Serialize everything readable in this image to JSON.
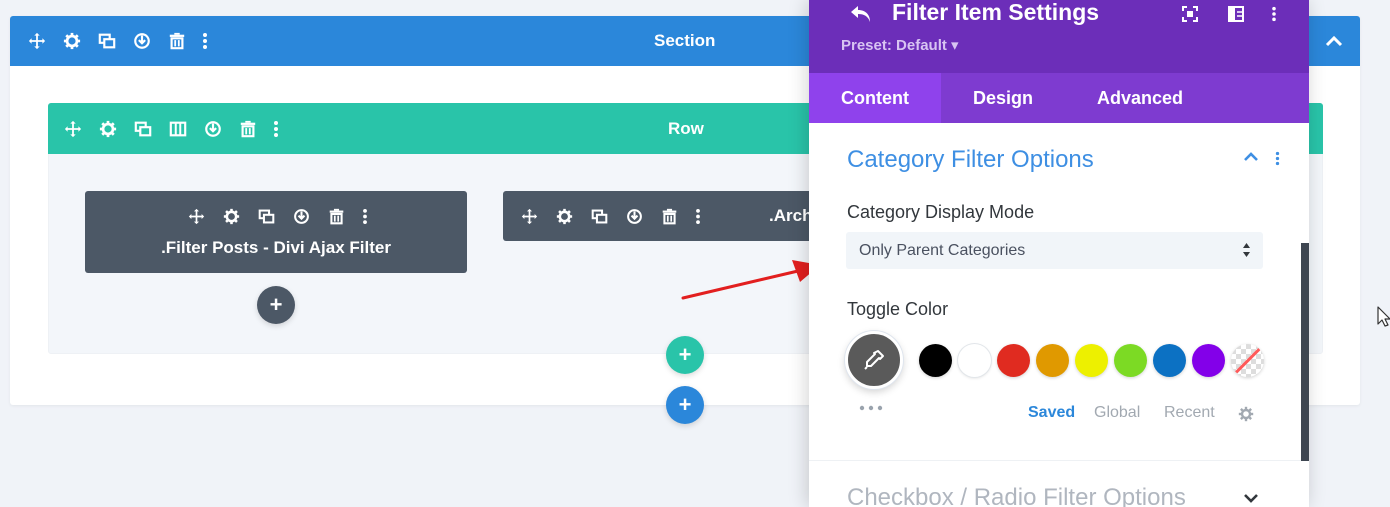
{
  "section": {
    "title": "Section"
  },
  "row": {
    "title": "Row"
  },
  "modules": [
    {
      "title": ".Filter Posts - Divi Ajax Filter"
    },
    {
      "title": ".Arch"
    }
  ],
  "add_buttons": {
    "symbol": "+"
  },
  "colors": {
    "section_bar": "#2b87da",
    "row_bar": "#29c4a9",
    "module_bg": "#4c5866",
    "panel_header": "#6c2eb9",
    "panel_tabs": "#7e3bd0",
    "panel_tab_active": "#8f42ec",
    "group_title": "#3e8fe3",
    "arrow": "#e21f1f"
  },
  "panel": {
    "title": "Filter Item Settings",
    "preset": "Preset: Default ▾",
    "header_icons": [
      "undo-icon",
      "focus-mode-icon",
      "split-view-icon",
      "more-vertical-icon"
    ],
    "tabs": [
      {
        "label": "Content",
        "active": true
      },
      {
        "label": "Design",
        "active": false
      },
      {
        "label": "Advanced",
        "active": false
      }
    ],
    "group": {
      "title": "Category Filter Options",
      "fields": {
        "display_mode": {
          "label": "Category Display Mode",
          "value": "Only Parent Categories"
        },
        "toggle_color": {
          "label": "Toggle Color",
          "current": "#5a5a5a",
          "swatches": [
            {
              "name": "black",
              "color": "#000000"
            },
            {
              "name": "white",
              "color": "#ffffff"
            },
            {
              "name": "red",
              "color": "#e02b20"
            },
            {
              "name": "orange",
              "color": "#e09900"
            },
            {
              "name": "yellow",
              "color": "#edf000"
            },
            {
              "name": "green",
              "color": "#7cda24"
            },
            {
              "name": "blue",
              "color": "#0c71c3"
            },
            {
              "name": "purple",
              "color": "#8300e9"
            },
            {
              "name": "transparent",
              "color": "transparent"
            }
          ],
          "palette_tabs": [
            {
              "label": "Saved",
              "active": true
            },
            {
              "label": "Global",
              "active": false
            },
            {
              "label": "Recent",
              "active": false
            }
          ]
        }
      }
    },
    "next_group": {
      "title": "Checkbox / Radio Filter Options"
    }
  }
}
